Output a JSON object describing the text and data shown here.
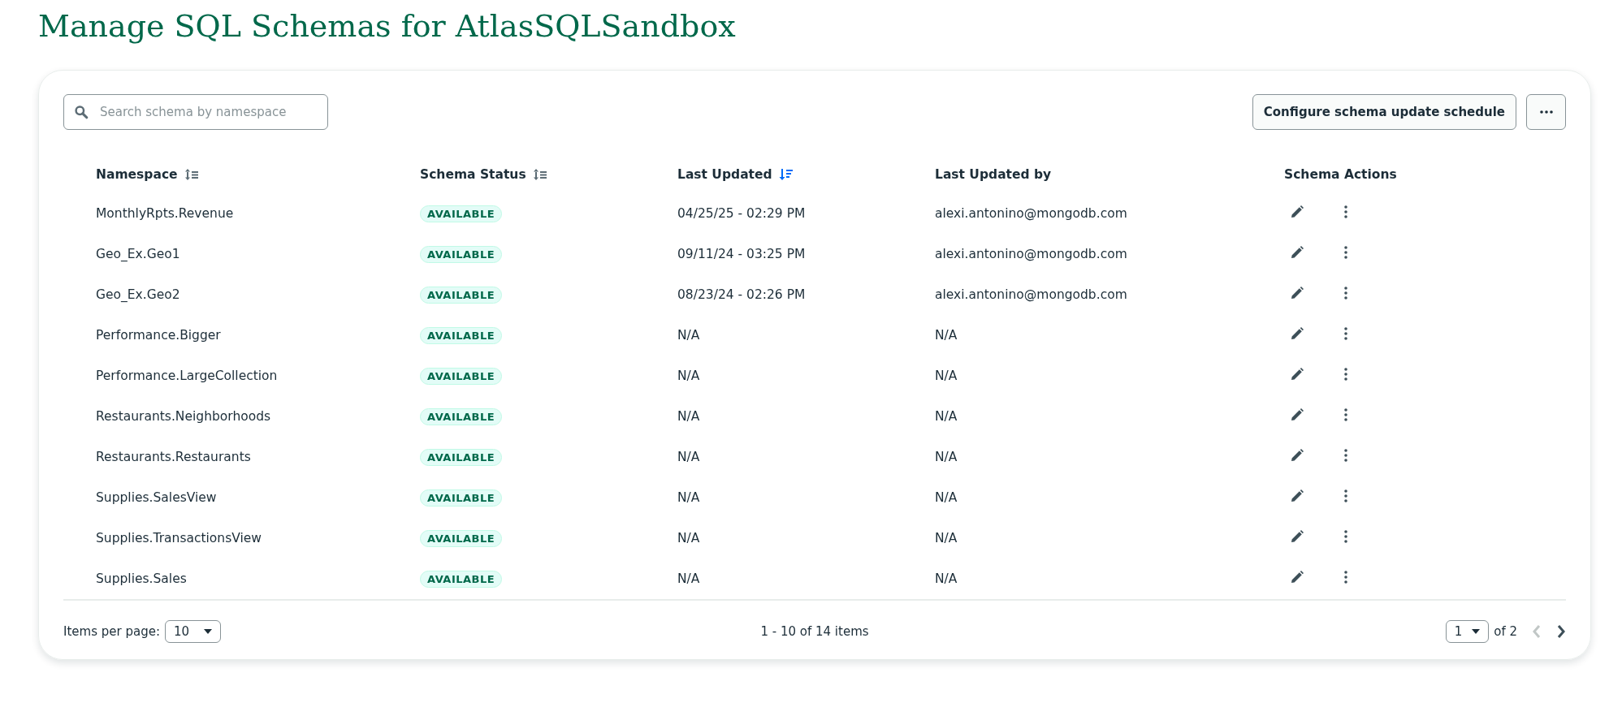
{
  "page": {
    "title": "Manage SQL Schemas for AtlasSQLSandbox"
  },
  "toolbar": {
    "search": {
      "placeholder": "Search schema by namespace"
    },
    "configure_button": "Configure schema update schedule"
  },
  "table": {
    "columns": [
      {
        "label": "Namespace",
        "sortable": true,
        "sorted": false
      },
      {
        "label": "Schema Status",
        "sortable": true,
        "sorted": false
      },
      {
        "label": "Last Updated",
        "sortable": true,
        "sorted": true
      },
      {
        "label": "Last Updated by",
        "sortable": false
      },
      {
        "label": "Schema Actions",
        "sortable": false
      }
    ],
    "rows": [
      {
        "namespace": "MonthlyRpts.Revenue",
        "status": "AVAILABLE",
        "last_updated": "04/25/25 - 02:29 PM",
        "updated_by": "alexi.antonino@mongodb.com"
      },
      {
        "namespace": "Geo_Ex.Geo1",
        "status": "AVAILABLE",
        "last_updated": "09/11/24 - 03:25 PM",
        "updated_by": "alexi.antonino@mongodb.com"
      },
      {
        "namespace": "Geo_Ex.Geo2",
        "status": "AVAILABLE",
        "last_updated": "08/23/24 - 02:26 PM",
        "updated_by": "alexi.antonino@mongodb.com"
      },
      {
        "namespace": "Performance.Bigger",
        "status": "AVAILABLE",
        "last_updated": "N/A",
        "updated_by": "N/A"
      },
      {
        "namespace": "Performance.LargeCollection",
        "status": "AVAILABLE",
        "last_updated": "N/A",
        "updated_by": "N/A"
      },
      {
        "namespace": "Restaurants.Neighborhoods",
        "status": "AVAILABLE",
        "last_updated": "N/A",
        "updated_by": "N/A"
      },
      {
        "namespace": "Restaurants.Restaurants",
        "status": "AVAILABLE",
        "last_updated": "N/A",
        "updated_by": "N/A"
      },
      {
        "namespace": "Supplies.SalesView",
        "status": "AVAILABLE",
        "last_updated": "N/A",
        "updated_by": "N/A"
      },
      {
        "namespace": "Supplies.TransactionsView",
        "status": "AVAILABLE",
        "last_updated": "N/A",
        "updated_by": "N/A"
      },
      {
        "namespace": "Supplies.Sales",
        "status": "AVAILABLE",
        "last_updated": "N/A",
        "updated_by": "N/A"
      }
    ]
  },
  "pagination": {
    "items_per_page_label": "Items per page:",
    "items_per_page": "10",
    "range": "1 - 10 of 14 items",
    "page": "1",
    "of_pages": "of 2",
    "prev_disabled": true,
    "next_disabled": false
  }
}
